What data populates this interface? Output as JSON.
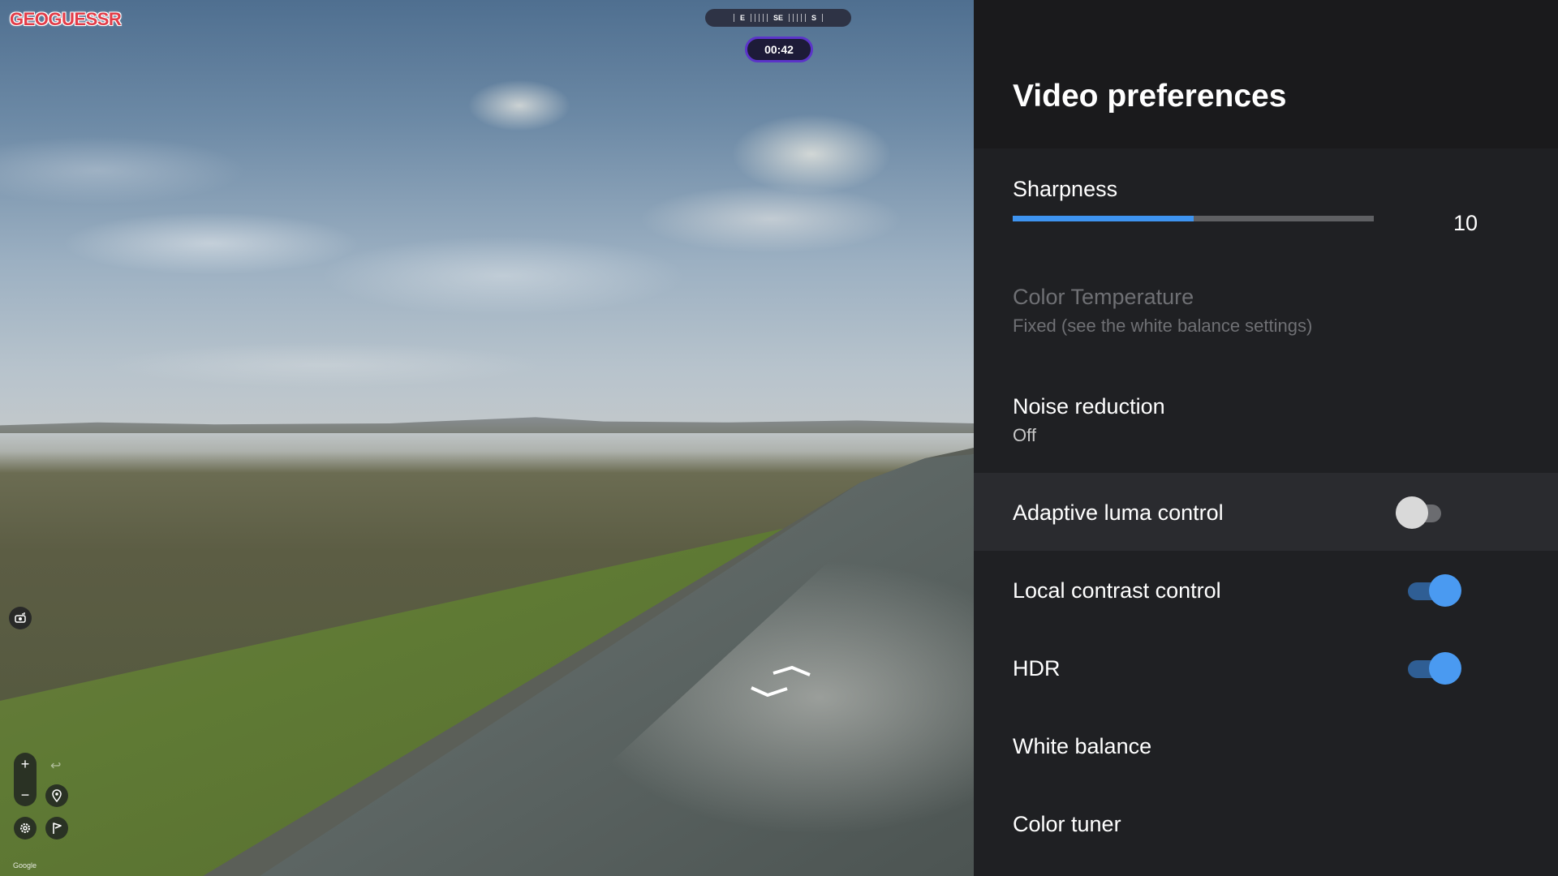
{
  "game": {
    "logo": "GEOGUESSR",
    "compass": {
      "left": "E",
      "center": "SE",
      "right": "S"
    },
    "timer": "00:42",
    "zoom_in": "+",
    "zoom_out": "−",
    "google_mark": "Google",
    "icons": [
      "camera-reset-icon",
      "undo-icon",
      "pin-icon",
      "settings-icon",
      "flag-icon",
      "nav-arrow-forward-icon",
      "nav-arrow-back-icon"
    ]
  },
  "panel": {
    "title": "Video preferences",
    "sharpness": {
      "label": "Sharpness",
      "value": "10",
      "fill_fraction": 0.5
    },
    "color_temperature": {
      "label": "Color Temperature",
      "sub": "Fixed (see the white balance settings)"
    },
    "noise_reduction": {
      "label": "Noise reduction",
      "sub": "Off"
    },
    "adaptive_luma": {
      "label": "Adaptive luma control",
      "state": "off"
    },
    "local_contrast": {
      "label": "Local contrast control",
      "state": "on"
    },
    "hdr": {
      "label": "HDR",
      "state": "on"
    },
    "white_balance": {
      "label": "White balance"
    },
    "color_tuner": {
      "label": "Color tuner"
    },
    "colors": {
      "accent": "#3e94f0",
      "toggle_on_track": "#2f5e94",
      "panel_bg": "#1f2023",
      "highlight_row": "#2a2b2f"
    }
  }
}
